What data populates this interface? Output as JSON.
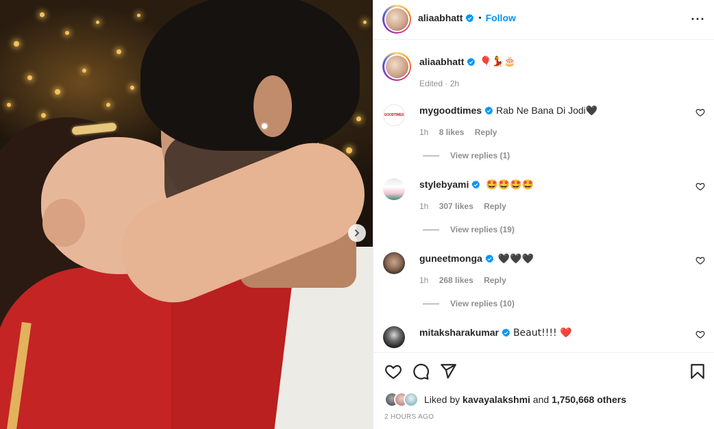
{
  "post": {
    "author": "aliaabhatt",
    "follow_label": "Follow",
    "dot": "•",
    "more_label": "···",
    "caption": "🎈💃🎂",
    "caption_meta": "Edited · 2h"
  },
  "comments": [
    {
      "user": "mygoodtimes",
      "text": "Rab Ne Bana Di Jodi🖤",
      "time": "1h",
      "likes": "8 likes",
      "reply_label": "Reply",
      "view_replies": "View replies (1)",
      "avatar_text": "GOODTIMES"
    },
    {
      "user": "stylebyami",
      "text": "🤩🤩🤩🤩",
      "time": "1h",
      "likes": "307 likes",
      "reply_label": "Reply",
      "view_replies": "View replies (19)"
    },
    {
      "user": "guneetmonga",
      "text": "🖤🖤🖤",
      "time": "1h",
      "likes": "268 likes",
      "reply_label": "Reply",
      "view_replies": "View replies (10)"
    },
    {
      "user": "mitaksharakumar",
      "text": "Beaut!!!! ❤️"
    }
  ],
  "likes": {
    "prefix": "Liked by",
    "user": "kavayalakshmi",
    "middle": "and",
    "count": "1,750,668 others"
  },
  "timestamp": "2 HOURS AGO",
  "icons": {
    "verified": "verified-badge-icon",
    "like": "heart-outline-icon",
    "comment": "comment-bubble-icon",
    "share": "paper-plane-icon",
    "save": "bookmark-icon",
    "more": "ellipsis-icon",
    "next": "chevron-right-icon"
  },
  "colors": {
    "accent": "#0095f6",
    "verified": "#0095f6",
    "heart_red": "#ed4956",
    "text": "#262626",
    "muted": "#8e8e8e"
  }
}
